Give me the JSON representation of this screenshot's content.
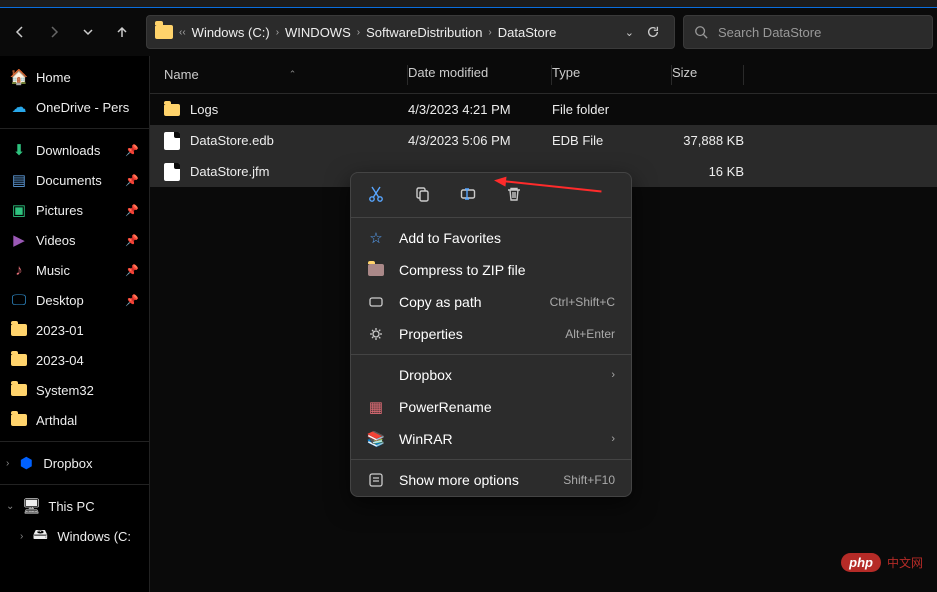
{
  "breadcrumb": [
    "Windows (C:)",
    "WINDOWS",
    "SoftwareDistribution",
    "DataStore"
  ],
  "search": {
    "placeholder": "Search DataStore"
  },
  "sidebar": {
    "home": "Home",
    "onedrive": "OneDrive - Pers",
    "quick": [
      {
        "label": "Downloads",
        "icon": "download",
        "pin": true
      },
      {
        "label": "Documents",
        "icon": "doc",
        "pin": true
      },
      {
        "label": "Pictures",
        "icon": "pic",
        "pin": true
      },
      {
        "label": "Videos",
        "icon": "vid",
        "pin": true
      },
      {
        "label": "Music",
        "icon": "music",
        "pin": true
      },
      {
        "label": "Desktop",
        "icon": "desktop",
        "pin": true
      },
      {
        "label": "2023-01",
        "icon": "folder",
        "pin": false
      },
      {
        "label": "2023-04",
        "icon": "folder",
        "pin": false
      },
      {
        "label": "System32",
        "icon": "folder",
        "pin": false
      },
      {
        "label": "Arthdal",
        "icon": "folder",
        "pin": false
      }
    ],
    "dropbox": "Dropbox",
    "thispc": "This PC",
    "win": "Windows (C:"
  },
  "columns": {
    "name": "Name",
    "date": "Date modified",
    "type": "Type",
    "size": "Size"
  },
  "rows": [
    {
      "name": "Logs",
      "date": "4/3/2023 4:21 PM",
      "type": "File folder",
      "size": "",
      "icon": "folder",
      "selected": false
    },
    {
      "name": "DataStore.edb",
      "date": "4/3/2023 5:06 PM",
      "type": "EDB File",
      "size": "37,888 KB",
      "icon": "file",
      "selected": true
    },
    {
      "name": "DataStore.jfm",
      "date": "",
      "type": "",
      "size": "16 KB",
      "icon": "file",
      "selected": true
    }
  ],
  "ctx": {
    "fav": "Add to Favorites",
    "zip": "Compress to ZIP file",
    "copy_path": "Copy as path",
    "copy_path_short": "Ctrl+Shift+C",
    "props": "Properties",
    "props_short": "Alt+Enter",
    "dropbox": "Dropbox",
    "rename": "PowerRename",
    "winrar": "WinRAR",
    "more": "Show more options",
    "more_short": "Shift+F10"
  },
  "watermark": {
    "badge": "php",
    "text": "中文网"
  }
}
